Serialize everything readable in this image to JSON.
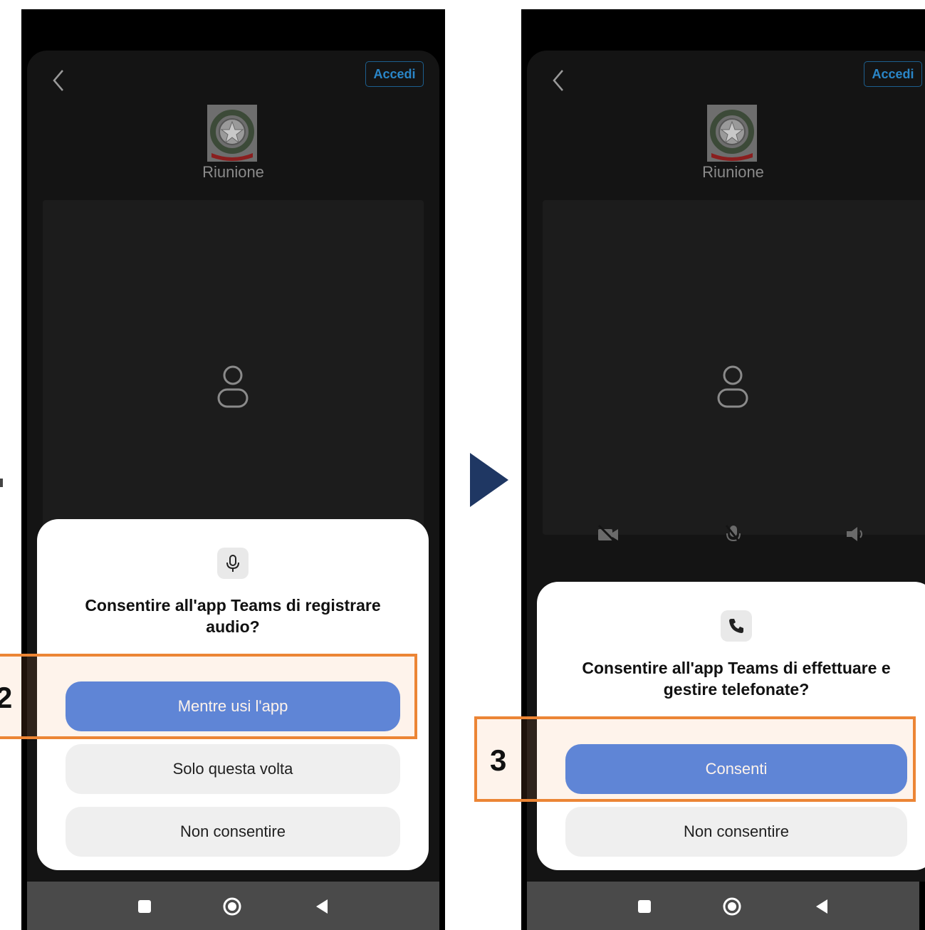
{
  "left_screen": {
    "header": {
      "login_label": "Accedi"
    },
    "meeting": {
      "title": "Riunione"
    },
    "permission_dialog": {
      "title": "Consentire all'app Teams di registrare audio?",
      "icon": "microphone-icon",
      "buttons": [
        "Mentre usi l'app",
        "Solo questa volta",
        "Non consentire"
      ]
    },
    "step_label": "2"
  },
  "right_screen": {
    "header": {
      "login_label": "Accedi"
    },
    "meeting": {
      "title": "Riunione"
    },
    "toolbar_icons": [
      "camera-off-icon",
      "mic-off-icon",
      "speaker-icon"
    ],
    "permission_dialog": {
      "title": "Consentire all'app Teams di effettuare e gestire telefonate?",
      "icon": "phone-icon",
      "buttons": [
        "Consenti",
        "Non consentire"
      ]
    },
    "step_label": "3"
  },
  "navbar_icons": [
    "recents-square-icon",
    "home-circle-icon",
    "back-triangle-icon"
  ],
  "colors": {
    "primary_button": "#4a82e8",
    "highlight_border": "#ec8535",
    "arrow": "#1f3763",
    "accent_link": "#2a86c8"
  }
}
